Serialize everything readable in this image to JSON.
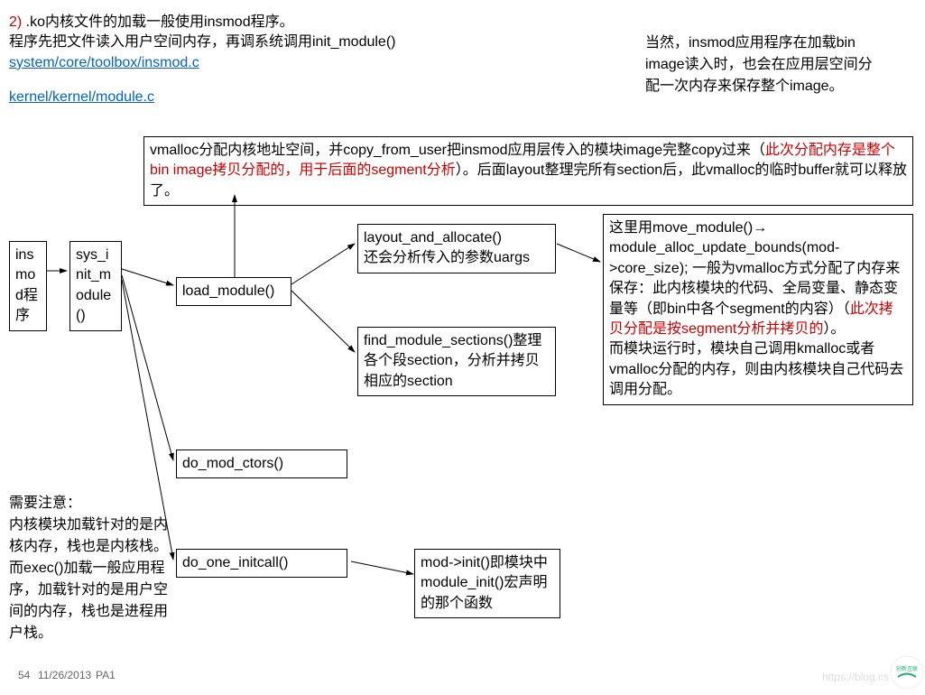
{
  "header": {
    "bullet": "2)",
    "line1_rest": " .ko内核文件的加载一般使用insmod程序。",
    "line2": "程序先把文件读入用户空间内存，再调系统调用init_module()",
    "link1": "system/core/toolbox/insmod.c",
    "link2": "kernel/kernel/module.c"
  },
  "side_note": "当然，insmod应用程序在加载bin image读入时，也会在应用层空间分配一次内存来保存整个image。",
  "nodes": {
    "insmod": "insmod程序",
    "sys_init": "sys_init_module()",
    "load_module": "load_module()",
    "do_mod_ctors": "do_mod_ctors()",
    "do_one_initcall": "do_one_initcall()",
    "layout": "layout_and_allocate()\n还会分析传入的参数uargs",
    "find_module": "find_module_sections()整理各个段section，分析并拷贝相应的section",
    "mod_init": "mod->init()即模块中module_init()宏声明的那个函数"
  },
  "vmalloc_box": {
    "p1a": "vmalloc分配内核地址空间，并copy_from_user把insmod应用层传入的模块image完整copy过来（",
    "p1_red": "此次分配内存是整个bin image拷贝分配的，用于后面的segment分析",
    "p1b": "）。后面layout整理完所有section后，此vmalloc的临时buffer就可以释放了。"
  },
  "move_module_box": {
    "l1a": "这里用move_module()",
    "l1_arrow": "→",
    "l1b": " module_alloc_update_bounds(mod->core_size); 一般为vmalloc方式分配了内存来保存：此内核模块的代码、全局变量、静态变量等（即bin中各个segment的内容）（",
    "l1_red": "此次拷贝分配是按segment分析并拷贝的",
    "l1c": "）。",
    "l2": "而模块运行时，模块自己调用kmalloc或者vmalloc分配的内存，则由内核模块自己代码去调用分配。"
  },
  "bottom_note": {
    "l1": "需要注意：",
    "l2": "内核模块加载针对的是内核内存，栈也是内核栈。",
    "l3": "而exec()加载一般应用程序，加载针对的是用户空间的内存，栈也是进程用户栈。"
  },
  "footer": {
    "page": "54",
    "date": "11/26/2013",
    "code": "PA1"
  },
  "watermark": "https://blog.cs",
  "logo_name": "创新互联"
}
